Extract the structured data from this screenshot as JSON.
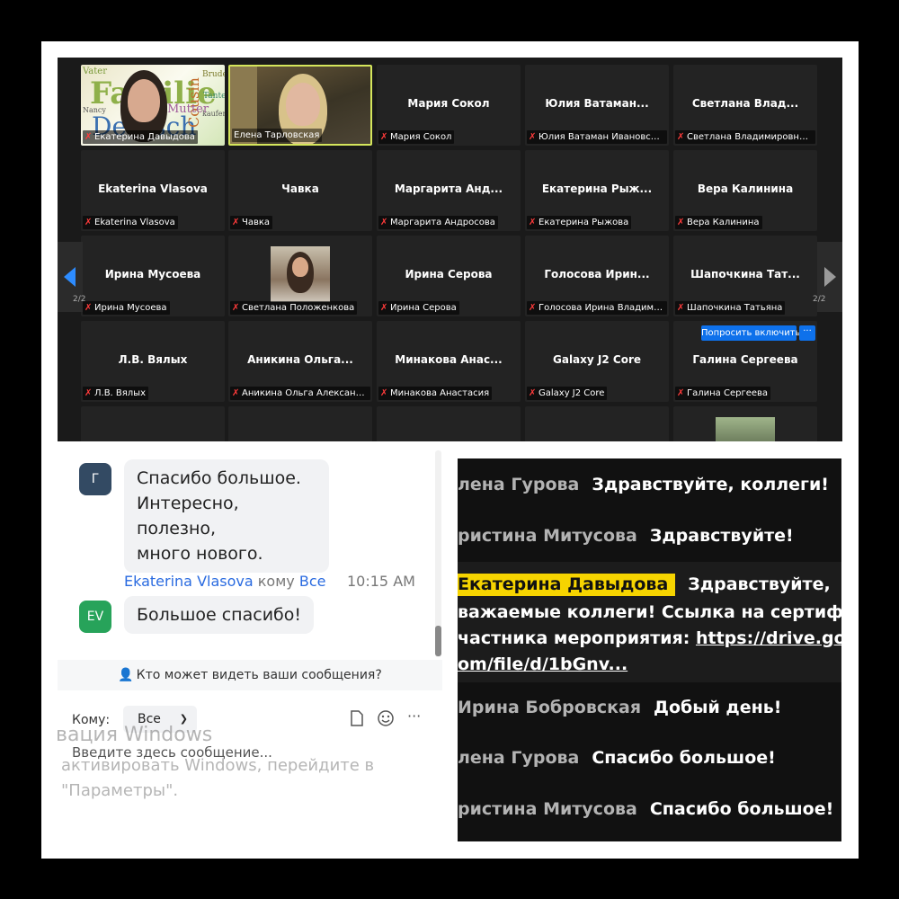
{
  "gallery": {
    "page_left": "2/2",
    "page_right": "2/2",
    "ask_button": "Попросить включить",
    "more_button": "···",
    "video_1": {
      "label": "Екатерина Давыдова",
      "words": [
        "Familie",
        "Deutsch",
        "Cousin",
        "Mutter",
        "Bruder",
        "Vater",
        "Tante",
        "kaufen",
        "Nancy"
      ]
    },
    "video_2": {
      "label": "Елена Тарловская"
    },
    "video_3": {
      "label": "Светлана Положенкова"
    },
    "tiles": [
      {
        "name": "Мария Сокол",
        "label": "Мария Сокол"
      },
      {
        "name": "Юлия Ватаман...",
        "label": "Юлия Ватаман Ивановская..."
      },
      {
        "name": "Светлана Влад...",
        "label": "Светлана Владимировна ..."
      },
      {
        "name": "Ekaterina Vlasova",
        "label": "Ekaterina Vlasova"
      },
      {
        "name": "Чавка",
        "label": "Чавка"
      },
      {
        "name": "Маргарита Анд...",
        "label": "Маргарита Андросова"
      },
      {
        "name": "Екатерина Рыж...",
        "label": "Екатерина Рыжова"
      },
      {
        "name": "Вера Калинина",
        "label": "Вера Калинина"
      },
      {
        "name": "Ирина Мусоева",
        "label": "Ирина Мусоева"
      },
      {
        "name": "Ирина Серова",
        "label": "Ирина Серова"
      },
      {
        "name": "Голосова Ирин...",
        "label": "Голосова Ирина Владими..."
      },
      {
        "name": "Шапочкина Тат...",
        "label": "Шапочкина Татьяна"
      },
      {
        "name": "Л.В. Вялых",
        "label": "Л.В. Вялых"
      },
      {
        "name": "Аникина Ольга...",
        "label": "Аникина Ольга Александр..."
      },
      {
        "name": "Минакова Анас...",
        "label": "Минакова Анастасия"
      },
      {
        "name": "Galaxy J2 Core",
        "label": "Galaxy J2 Core"
      },
      {
        "name": "Галина Сергеева",
        "label": "Галина Сергеева"
      }
    ]
  },
  "chat": {
    "msg1": {
      "avatar": "Г",
      "line1": "Спасибо большое.",
      "line2": "Интересно, полезно,",
      "line3": "много нового."
    },
    "msg2": {
      "sender": "Ekaterina Vlasova",
      "to": "кому",
      "target": "Все",
      "time": "10:15 AM",
      "avatar": "EV",
      "text": "Большое спасибо!"
    },
    "privacy": "Кто может видеть ваши сообщения?",
    "to_label": "Кому:",
    "select_value": "Все",
    "input_placeholder": "Введите здесь сообщение...",
    "watermark1": "вация Windows",
    "watermark2": "активировать Windows, перейдите в",
    "watermark3": "\"Параметры\".",
    "colors": {
      "avatar_g": "#334a63",
      "avatar_ev": "#27a35a",
      "link": "#2a6be0"
    }
  },
  "captions": {
    "lines": [
      {
        "name": "лена Гурова",
        "msg": "Здравствуйте, коллеги!"
      },
      {
        "name": "ристина Митусова",
        "msg": "Здравствуйте!"
      },
      {
        "name": "Ирина Бобровская",
        "msg": "Добый день!"
      },
      {
        "name": "лена Гурова",
        "msg": "Спасибо большое!"
      },
      {
        "name": "ристина Митусова",
        "msg": "Спасибо большое!"
      }
    ],
    "highlight": {
      "name": "Екатерина Давыдова",
      "line1": "Здравствуйте,",
      "line2": "важаемые коллеги! Ссылка на сертифи",
      "line3a": "частника мероприятия: ",
      "line3b": "https://drive.goo",
      "line4": "om/file/d/1bGnv..."
    },
    "colors": {
      "highlight": "#f6d400"
    }
  }
}
